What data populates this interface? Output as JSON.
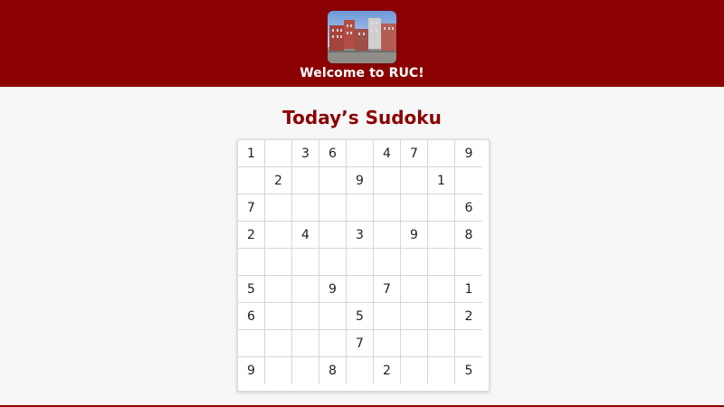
{
  "header": {
    "welcome_text": "Welcome to RUC!",
    "image_icon": "campus-building-photo-icon",
    "background_color": "#8b0000"
  },
  "main": {
    "title": "Today’s Sudoku",
    "title_color": "#8b0000"
  },
  "sudoku": {
    "grid": [
      [
        "1",
        "",
        "3",
        "6",
        "",
        "4",
        "7",
        "",
        "9"
      ],
      [
        "",
        "2",
        "",
        "",
        "9",
        "",
        "",
        "1",
        ""
      ],
      [
        "7",
        "",
        "",
        "",
        "",
        "",
        "",
        "",
        "6"
      ],
      [
        "2",
        "",
        "4",
        "",
        "3",
        "",
        "9",
        "",
        "8"
      ],
      [
        "",
        "",
        "",
        "",
        "",
        "",
        "",
        "",
        ""
      ],
      [
        "5",
        "",
        "",
        "9",
        "",
        "7",
        "",
        "",
        "1"
      ],
      [
        "6",
        "",
        "",
        "",
        "5",
        "",
        "",
        "",
        "2"
      ],
      [
        "",
        "",
        "",
        "",
        "7",
        "",
        "",
        "",
        ""
      ],
      [
        "9",
        "",
        "",
        "8",
        "",
        "2",
        "",
        "",
        "5"
      ]
    ]
  }
}
